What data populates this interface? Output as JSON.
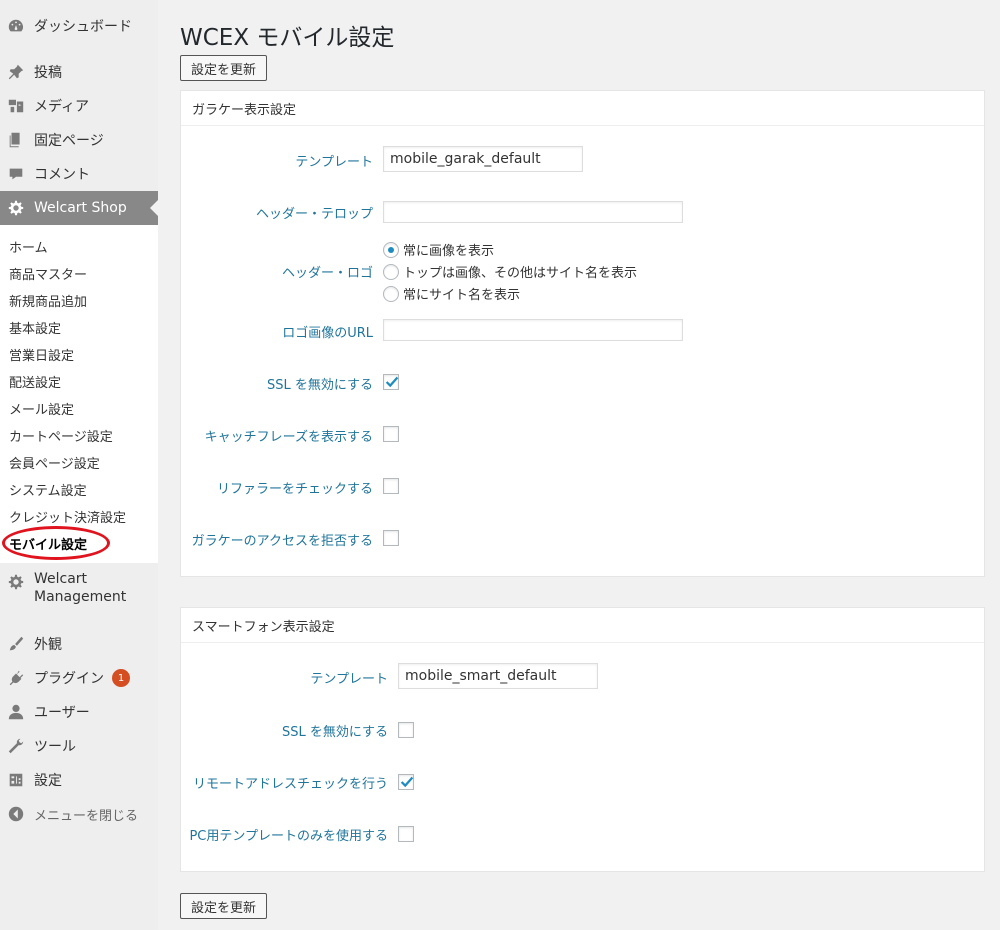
{
  "sidebar": {
    "menu": [
      {
        "label": "ダッシュボード",
        "icon": "dashboard-icon"
      },
      {
        "label": "投稿",
        "icon": "pin-icon"
      },
      {
        "label": "メディア",
        "icon": "media-icon"
      },
      {
        "label": "固定ページ",
        "icon": "page-icon"
      },
      {
        "label": "コメント",
        "icon": "comment-icon"
      },
      {
        "label": "Welcart Shop",
        "icon": "gear-icon"
      }
    ],
    "submenu": [
      "ホーム",
      "商品マスター",
      "新規商品追加",
      "基本設定",
      "営業日設定",
      "配送設定",
      "メール設定",
      "カートページ設定",
      "会員ページ設定",
      "システム設定",
      "クレジット決済設定",
      "モバイル設定"
    ],
    "management": {
      "line1": "Welcart",
      "line2": "Management"
    },
    "lower": [
      {
        "label": "外観",
        "icon": "paintbrush-icon"
      },
      {
        "label": "プラグイン",
        "icon": "plugin-icon",
        "badge": "1"
      },
      {
        "label": "ユーザー",
        "icon": "user-icon"
      },
      {
        "label": "ツール",
        "icon": "wrench-icon"
      },
      {
        "label": "設定",
        "icon": "settings-icon"
      }
    ],
    "collapse": "メニューを閉じる"
  },
  "page": {
    "title": "WCEX モバイル設定",
    "update_button": "設定を更新"
  },
  "garake": {
    "heading": "ガラケー表示設定",
    "template_label": "テンプレート",
    "template_value": "mobile_garak_default",
    "header_telop_label": "ヘッダー・テロップ",
    "header_telop_value": "",
    "header_logo_label": "ヘッダー・ロゴ",
    "logo_options": [
      "常に画像を表示",
      "トップは画像、その他はサイト名を表示",
      "常にサイト名を表示"
    ],
    "logo_selected": 0,
    "logo_url_label": "ロゴ画像のURL",
    "logo_url_value": "",
    "ssl_label": "SSL を無効にする",
    "ssl_checked": true,
    "catch_label": "キャッチフレーズを表示する",
    "catch_checked": false,
    "referer_label": "リファラーをチェックする",
    "referer_checked": false,
    "deny_label": "ガラケーのアクセスを拒否する",
    "deny_checked": false
  },
  "smart": {
    "heading": "スマートフォン表示設定",
    "template_label": "テンプレート",
    "template_value": "mobile_smart_default",
    "ssl_label": "SSL を無効にする",
    "ssl_checked": false,
    "remote_label": "リモートアドレスチェックを行う",
    "remote_checked": true,
    "pc_label": "PC用テンプレートのみを使用する",
    "pc_checked": false
  },
  "colors": {
    "accent": "#21759b",
    "active_menu": "#888888",
    "badge": "#d54e21",
    "highlight_circle": "#e0141e"
  }
}
